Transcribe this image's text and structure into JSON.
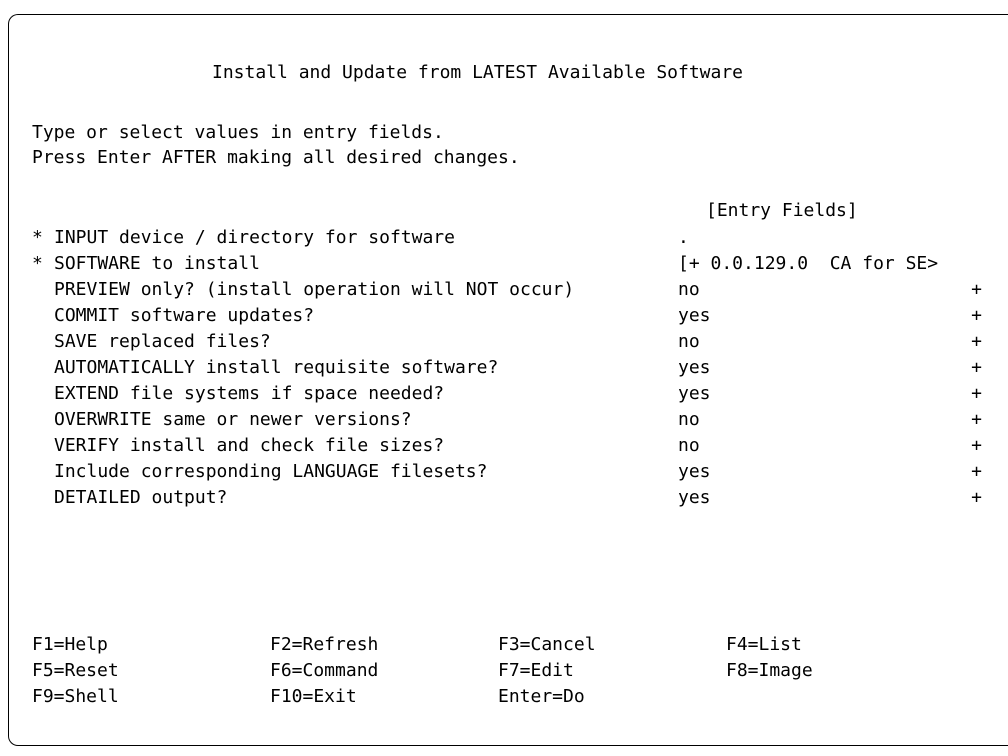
{
  "title": "Install and Update from LATEST Available Software",
  "instructions": [
    "Type or select values in entry fields.",
    "Press Enter AFTER making all desired changes."
  ],
  "entry_fields_header": "[Entry Fields]",
  "fields": [
    {
      "required": "*",
      "label": "INPUT device / directory for software",
      "value": ".",
      "list": ""
    },
    {
      "required": "*",
      "label": "SOFTWARE to install",
      "value": "[+ 0.0.129.0  CA for SE>",
      "list": ""
    },
    {
      "required": "",
      "label": "PREVIEW only? (install operation will NOT occur)",
      "value": "no",
      "list": "+"
    },
    {
      "required": "",
      "label": "COMMIT software updates?",
      "value": "yes",
      "list": "+"
    },
    {
      "required": "",
      "label": "SAVE replaced files?",
      "value": "no",
      "list": "+"
    },
    {
      "required": "",
      "label": "AUTOMATICALLY install requisite software?",
      "value": "yes",
      "list": "+"
    },
    {
      "required": "",
      "label": "EXTEND file systems if space needed?",
      "value": "yes",
      "list": "+"
    },
    {
      "required": "",
      "label": "OVERWRITE same or newer versions?",
      "value": "no",
      "list": "+"
    },
    {
      "required": "",
      "label": "VERIFY install and check file sizes?",
      "value": "no",
      "list": "+"
    },
    {
      "required": "",
      "label": "Include corresponding LANGUAGE filesets?",
      "value": "yes",
      "list": "+"
    },
    {
      "required": "",
      "label": "DETAILED output?",
      "value": "yes",
      "list": "+"
    }
  ],
  "function_keys": [
    [
      "F1=Help",
      "F2=Refresh",
      "F3=Cancel",
      "F4=List"
    ],
    [
      "F5=Reset",
      "F6=Command",
      "F7=Edit",
      "F8=Image"
    ],
    [
      "F9=Shell",
      "F10=Exit",
      "Enter=Do",
      ""
    ]
  ]
}
